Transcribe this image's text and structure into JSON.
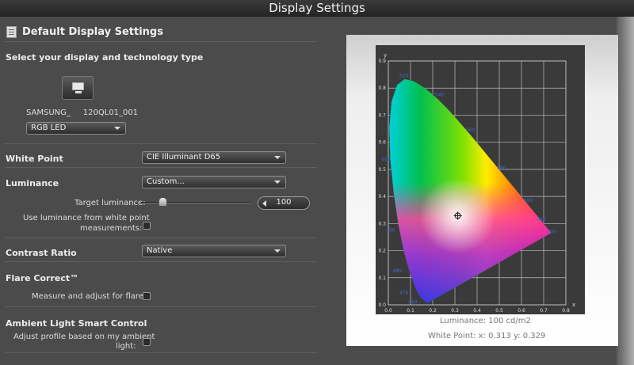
{
  "window": {
    "title": "Display Settings"
  },
  "header": {
    "title": "Default Display Settings",
    "icon": "document-icon"
  },
  "display_section": {
    "title": "Select your display and technology type",
    "display_name": "SAMSUNG_     120QL01_001",
    "technology": "RGB LED",
    "icon": "monitor-icon"
  },
  "white_point": {
    "label": "White Point",
    "value": "CIE Illuminant D65"
  },
  "luminance": {
    "label": "Luminance",
    "value": "Custom...",
    "target_label": "Target luminance:",
    "target_value": "100",
    "slider_fraction": 0.2,
    "use_from_white_label_1": "Use luminance from white point",
    "use_from_white_label_2": "measurements:"
  },
  "contrast": {
    "label": "Contrast Ratio",
    "value": "Native"
  },
  "flare": {
    "title": "Flare Correct™",
    "measure_label": "Measure and adjust for flare:"
  },
  "ambient": {
    "title": "Ambient Light Smart Control",
    "adjust_label_1": "Adjust profile based on my ambient",
    "adjust_label_2": "light:"
  },
  "chart_info": {
    "luminance_label": "Luminance:",
    "luminance_value": "100 cd/m2",
    "white_point_label": "White Point: x:",
    "white_point_x": "0.313",
    "white_point_y_label": "y:",
    "white_point_y": "0.329"
  },
  "chart_data": {
    "type": "scatter",
    "title": "",
    "xlabel": "x",
    "ylabel": "y",
    "xlim": [
      0,
      0.8
    ],
    "ylim": [
      0,
      0.9
    ],
    "x_ticks": [
      "0.0",
      "0.1",
      "0.2",
      "0.3",
      "0.4",
      "0.5",
      "0.6",
      "0.7",
      "0.8"
    ],
    "y_ticks": [
      "0.0",
      "0.1",
      "0.2",
      "0.3",
      "0.4",
      "0.5",
      "0.6",
      "0.7",
      "0.8",
      "0.9"
    ],
    "grid": true,
    "white_point": {
      "x": 0.313,
      "y": 0.329
    },
    "wavelength_labels": [
      {
        "label": "520",
        "x": 0.07,
        "y": 0.84
      },
      {
        "label": "540",
        "x": 0.23,
        "y": 0.77
      },
      {
        "label": "560",
        "x": 0.37,
        "y": 0.64
      },
      {
        "label": "580",
        "x": 0.51,
        "y": 0.5
      },
      {
        "label": "600",
        "x": 0.63,
        "y": 0.38
      },
      {
        "label": "620",
        "x": 0.69,
        "y": 0.31
      },
      {
        "label": "700",
        "x": 0.735,
        "y": 0.265
      },
      {
        "label": "500",
        "x": -0.01,
        "y": 0.53
      },
      {
        "label": "490",
        "x": 0.01,
        "y": 0.27
      },
      {
        "label": "480",
        "x": 0.04,
        "y": 0.12
      },
      {
        "label": "470",
        "x": 0.07,
        "y": 0.04
      },
      {
        "label": "460",
        "x": 0.11,
        "y": 0.005
      }
    ]
  }
}
